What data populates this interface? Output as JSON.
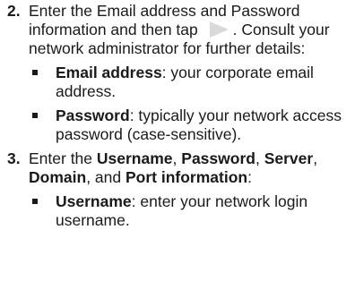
{
  "steps": [
    {
      "number": "2.",
      "text_before_icon": "Enter the Email address and Password information and then tap ",
      "icon": "next-arrow-icon",
      "text_after_icon": ". Consult your network administrator for further details:",
      "bullets": [
        {
          "term": "Email address",
          "description": ": your corporate email address."
        },
        {
          "term": "Password",
          "description": ": typically your network access password (case-sensitive)."
        }
      ]
    },
    {
      "number": "3.",
      "parts": [
        {
          "text": "Enter the ",
          "bold": false
        },
        {
          "text": "Username",
          "bold": true
        },
        {
          "text": ", ",
          "bold": false
        },
        {
          "text": "Password",
          "bold": true
        },
        {
          "text": ", ",
          "bold": false
        },
        {
          "text": "Server",
          "bold": true
        },
        {
          "text": ", ",
          "bold": false
        },
        {
          "text": "Domain",
          "bold": true
        },
        {
          "text": ", and ",
          "bold": false
        },
        {
          "text": "Port information",
          "bold": true
        },
        {
          "text": ":",
          "bold": false
        }
      ],
      "bullets": [
        {
          "term": "Username",
          "description": ": enter your network login username."
        }
      ]
    }
  ],
  "colors": {
    "text": "#1a1a1a",
    "icon_fill": "#d9d9d9"
  }
}
